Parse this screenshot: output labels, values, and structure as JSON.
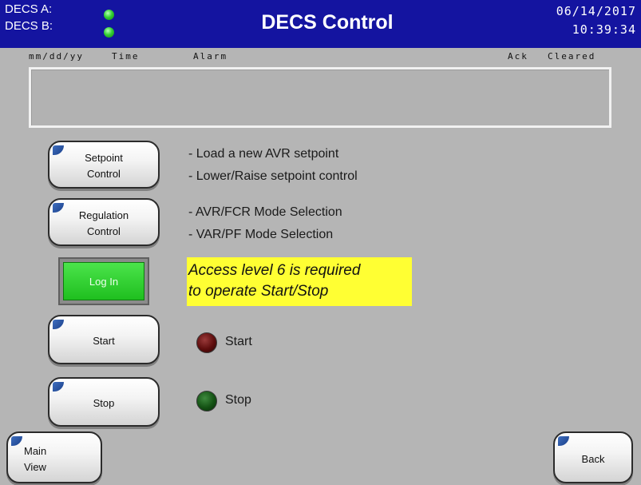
{
  "header": {
    "status_a_label": "DECS A:",
    "status_b_label": "DECS B:",
    "title": "DECS Control",
    "date": "06/14/2017",
    "time": "10:39:34",
    "status_a_color": "#2ecc2e",
    "status_b_color": "#2ecc2e"
  },
  "alarm_table": {
    "columns": [
      "mm/dd/yy",
      "Time",
      "Alarm",
      "Ack",
      "Cleared"
    ],
    "rows": []
  },
  "buttons": {
    "setpoint_line1": "Setpoint",
    "setpoint_line2": "Control",
    "regulation_line1": "Regulation",
    "regulation_line2": "Control",
    "login": "Log In",
    "start": "Start",
    "stop": "Stop",
    "main_view_line1": "Main",
    "main_view_line2": "View",
    "back": "Back"
  },
  "descriptions": {
    "setpoint_1": "- Load a new AVR setpoint",
    "setpoint_2": "- Lower/Raise setpoint control",
    "regulation_1": "- AVR/FCR Mode Selection",
    "regulation_2": "- VAR/PF Mode Selection"
  },
  "notice": {
    "line1": "Access level 6 is required",
    "line2": "to operate Start/Stop",
    "background": "#ffff33"
  },
  "indicators": {
    "start_label": "Start",
    "start_color": "#5e0d0d",
    "stop_label": "Stop",
    "stop_color": "#145214"
  },
  "icons": {
    "button_corner": "corner-tab-icon",
    "status_led": "led-icon"
  }
}
